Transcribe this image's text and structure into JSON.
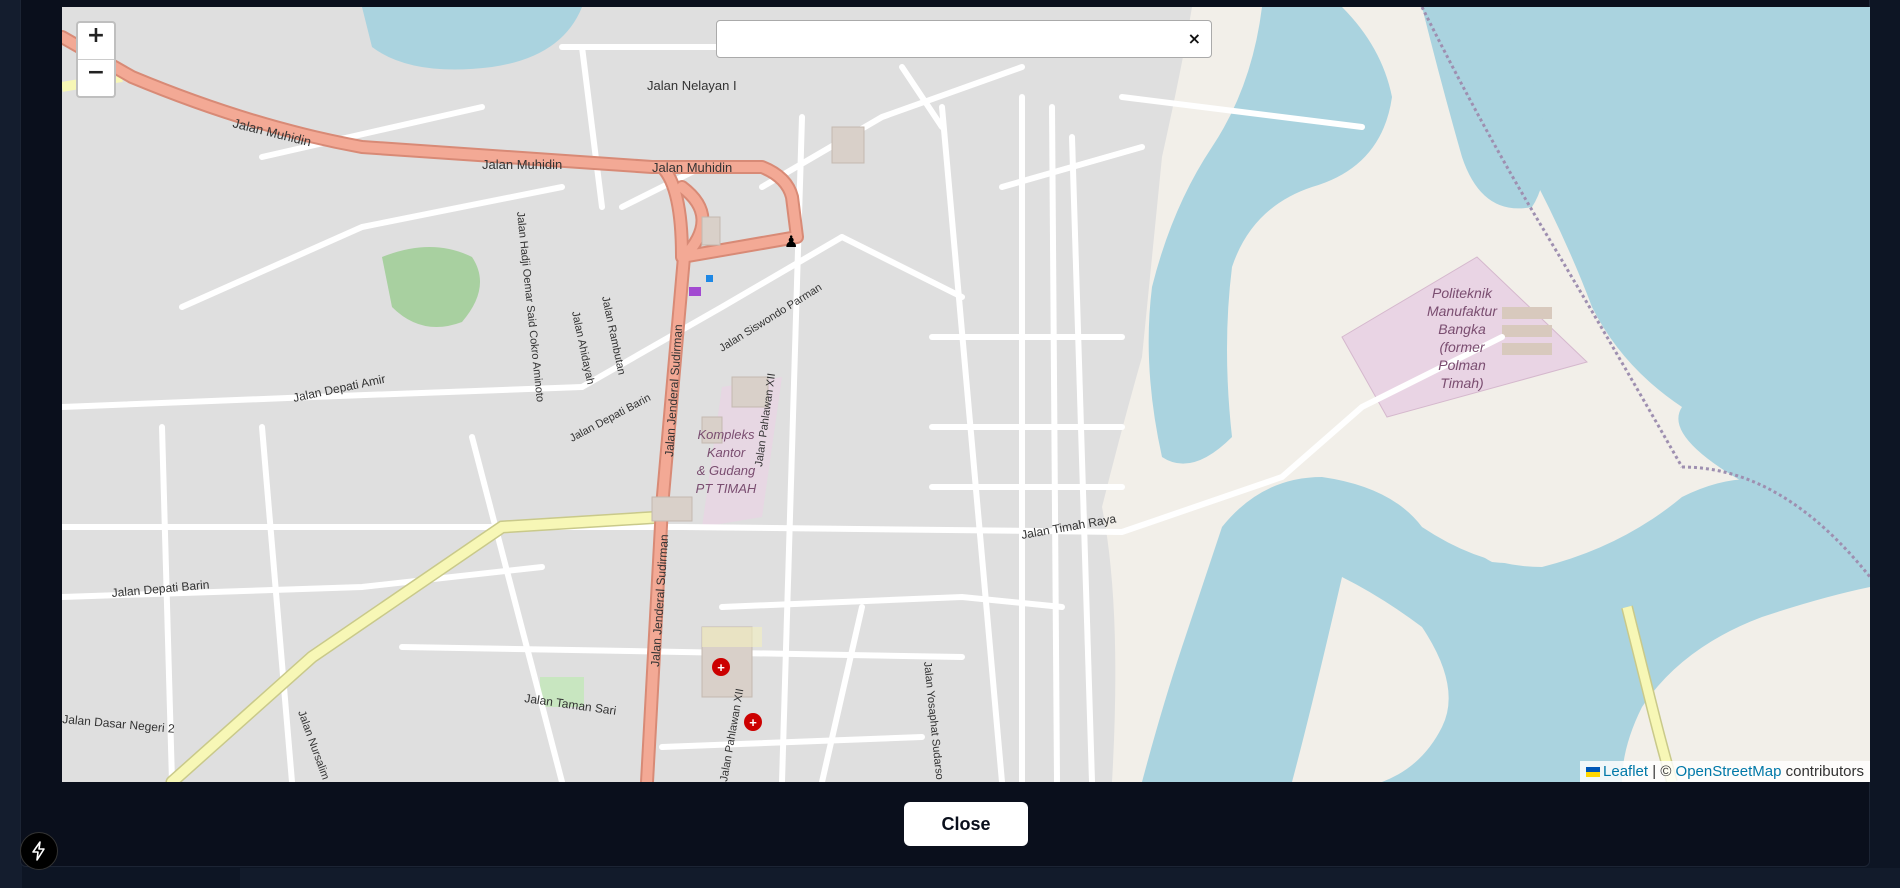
{
  "map": {
    "search_value": "",
    "search_placeholder": "",
    "search_clear": "×",
    "zoom_in": "+",
    "zoom_out": "−",
    "labels": {
      "jalan_nelayan_i": "Jalan Nelayan I",
      "jalan_muhidin": "Jalan Muhidin",
      "jalan_hadji_oemar": "Jalan Hadji Oemar Said Cokro Aminoto",
      "jalan_ahidayah": "Jalan Ahidayah",
      "jalan_rambutan": "Jalan Rambutan",
      "jalan_jenderal_sudirman": "Jalan Jenderal Sudirman",
      "jalan_siswondo_parman": "Jalan Siswondo Parman",
      "jalan_pahlawan_xii": "Jalan Pahlawan XII",
      "jalan_depati_amir": "Jalan Depati Amir",
      "jalan_depati_barin": "Jalan Depati Barin",
      "jalan_timah_raya": "Jalan Timah Raya",
      "jalan_taman_sari": "Jalan Taman Sari",
      "jalan_nursalim": "Jalan Nursalim",
      "jalan_yosaphat": "Jalan Yosaphat Sudarso",
      "jalan_dasar_negeri": "Jalan Dasar Negeri 2",
      "kompleks": [
        "Kompleks",
        "Kantor",
        "& Gudang",
        "PT TIMAH"
      ],
      "politeknik": [
        "Politeknik",
        "Manufaktur",
        "Bangka",
        "(former",
        "Polman",
        "Timah)"
      ]
    },
    "attribution": {
      "leaflet": "Leaflet",
      "separator": "| ©",
      "osm": "OpenStreetMap",
      "contributors": "contributors"
    },
    "colors": {
      "water": "#aad3df",
      "land": "#dfdfdf",
      "beach": "#f2efe9",
      "primary_road": "#f3a995",
      "secondary_road": "#f7f7b6",
      "park": "#a8d0a0",
      "campus": "#e9d4e4"
    }
  },
  "modal": {
    "close_label": "Close"
  },
  "icons": {
    "bolt": "bolt-icon"
  }
}
